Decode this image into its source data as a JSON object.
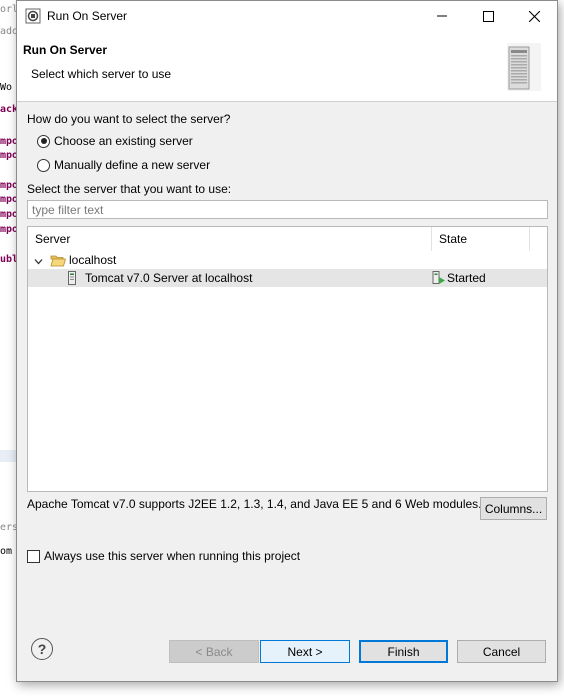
{
  "background_ide": {
    "fragments": [
      "orld",
      "ado",
      "Wo",
      "ack",
      "mpo",
      "mpo",
      "mpo",
      "mpo",
      "mpo",
      "mpo",
      "ubl",
      "ers",
      "om"
    ]
  },
  "window": {
    "title": "Run On Server",
    "controls": {
      "minimize": "minimize",
      "maximize": "maximize",
      "close": "close"
    }
  },
  "header": {
    "title": "Run On Server",
    "subtitle": "Select which server to use",
    "image": "server-banner-icon"
  },
  "selection": {
    "question": "How do you want to select the server?",
    "options": [
      {
        "label": "Choose an existing server",
        "checked": true
      },
      {
        "label": "Manually define a new server",
        "checked": false
      }
    ],
    "select_label": "Select the server that you want to use:",
    "filter_placeholder": "type filter text"
  },
  "table": {
    "columns": [
      "Server",
      "State"
    ],
    "tree": {
      "group": {
        "label": "localhost",
        "icon": "folder-open-icon",
        "expanded": true
      },
      "servers": [
        {
          "name": "Tomcat v7.0 Server at localhost",
          "state": "Started",
          "icon": "server-icon",
          "state_icon": "started-icon",
          "selected": true
        }
      ]
    }
  },
  "description": "Apache Tomcat v7.0 supports J2EE 1.2, 1.3, 1.4, and Java EE 5 and 6 Web modules.",
  "columns_button": "Columns...",
  "always_use": {
    "label": "Always use this server when running this project",
    "checked": false
  },
  "footer": {
    "help": "?",
    "back": "< Back",
    "next": "Next >",
    "finish": "Finish",
    "cancel": "Cancel"
  },
  "colors": {
    "accent": "#0078d7",
    "selection": "#e5e5e5",
    "dialog_bg": "#f0f0f0"
  }
}
